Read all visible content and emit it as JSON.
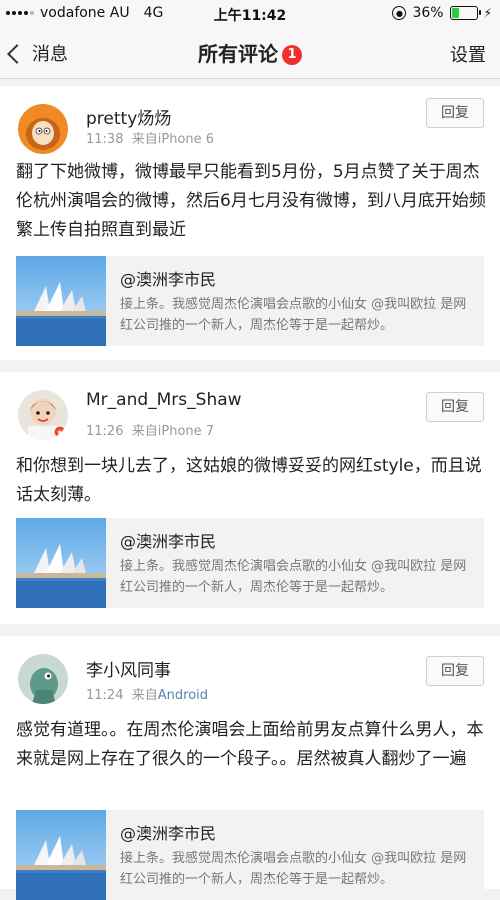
{
  "status": {
    "carrier": "vodafone AU",
    "network": "4G",
    "time": "上午11:42",
    "battery": "36%",
    "battery_level": 0.36
  },
  "nav": {
    "back_label": "消息",
    "title": "所有评论",
    "badge": "1",
    "settings_label": "设置"
  },
  "comments": [
    {
      "username": "pretty炀炀",
      "time": "11:38",
      "source_prefix": "来自",
      "source": "iPhone 6",
      "reply_label": "回复",
      "text": "翻了下她微博，微博最早只能看到5月份，5月点赞了关于周杰伦杭州演唱会的微博，然后6月七月没有微博，到八月底开始频繁上传自拍照直到最近",
      "quote": {
        "title": "@澳洲李市民",
        "text": "接上条。我感觉周杰伦演唱会点歌的小仙女 @我叫欧拉 是网红公司推的一个新人，周杰伦等于是一起帮炒。"
      }
    },
    {
      "username": "Mr_and_Mrs_Shaw",
      "time": "11:26",
      "source_prefix": "来自",
      "source": "iPhone 7",
      "reply_label": "回复",
      "text": "和你想到一块儿去了，这姑娘的微博妥妥的网红style，而且说话太刻薄。",
      "quote": {
        "title": "@澳洲李市民",
        "text": "接上条。我感觉周杰伦演唱会点歌的小仙女 @我叫欧拉 是网红公司推的一个新人，周杰伦等于是一起帮炒。"
      }
    },
    {
      "username": "李小风同事",
      "time": "11:24",
      "source_prefix": "来自",
      "source": "Android",
      "reply_label": "回复",
      "text": "感觉有道理。。在周杰伦演唱会上面给前男友点算什么男人，本来就是网上存在了很久的一个段子。。居然被真人翻炒了一遍",
      "quote": {
        "title": "@澳洲李市民",
        "text": "接上条。我感觉周杰伦演唱会点歌的小仙女 @我叫欧拉 是网红公司推的一个新人，周杰伦等于是一起帮炒。"
      }
    }
  ]
}
